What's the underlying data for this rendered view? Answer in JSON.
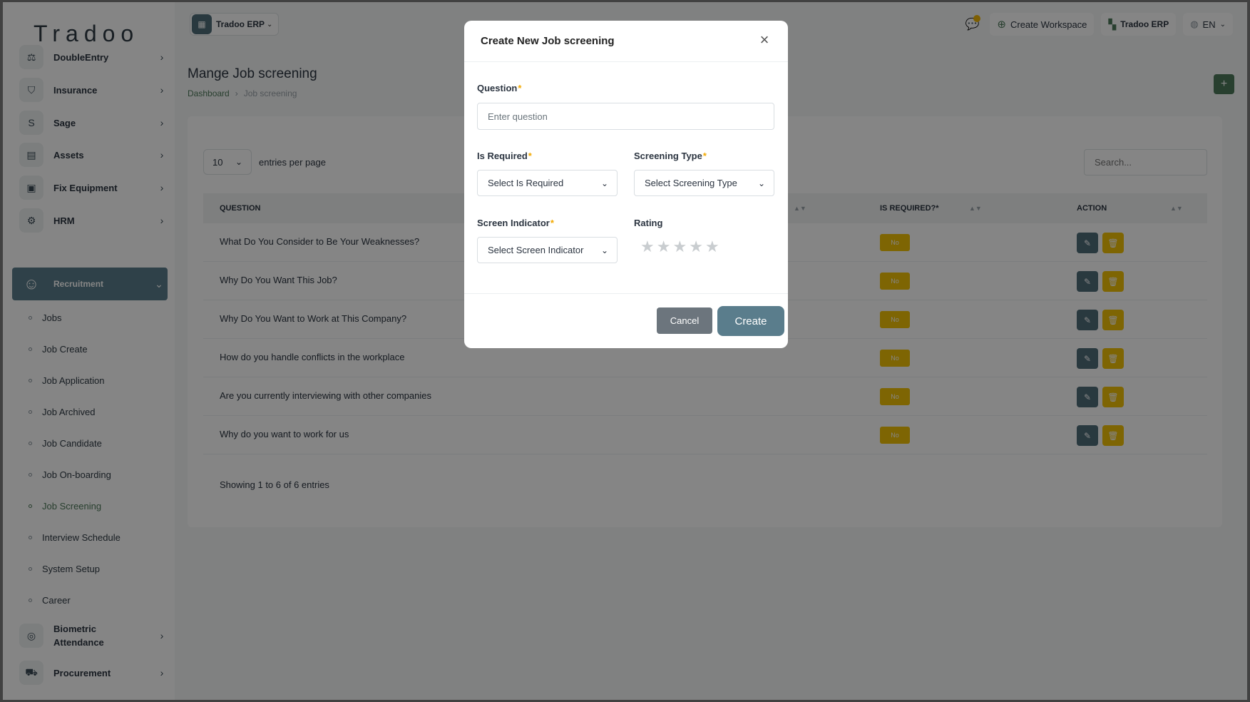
{
  "brand": {
    "logo_text": "Tradoo"
  },
  "sidebar": {
    "items": [
      {
        "label": "DoubleEntry",
        "icon": "scale-icon"
      },
      {
        "label": "Insurance",
        "icon": "shield-icon"
      },
      {
        "label": "Sage",
        "icon": "s-letter-icon"
      },
      {
        "label": "Assets",
        "icon": "calculator-icon"
      },
      {
        "label": "Fix Equipment",
        "icon": "archive-icon"
      },
      {
        "label": "HRM",
        "icon": "users-icon"
      },
      {
        "label": "Recruitment",
        "icon": "recruitment-icon"
      },
      {
        "label": "Biometric Attendance",
        "icon": "fingerprint-icon"
      },
      {
        "label": "Procurement",
        "icon": "cart-icon"
      }
    ],
    "recruitment_sub": [
      "Jobs",
      "Job Create",
      "Job Application",
      "Job Archived",
      "Job Candidate",
      "Job On-boarding",
      "Job Screening",
      "Interview Schedule",
      "System Setup",
      "Career"
    ],
    "active_sub": "Job Screening"
  },
  "topbar": {
    "workspace_label": "Tradoo ERP",
    "create_workspace": "Create Workspace",
    "erp_label": "Tradoo ERP",
    "language": "EN"
  },
  "page": {
    "title": "Mange Job screening",
    "breadcrumb": {
      "home": "Dashboard",
      "current": "Job screening"
    }
  },
  "table": {
    "entries_value": "10",
    "entries_label": "entries per page",
    "search_placeholder": "Search...",
    "headers": {
      "question": "QUESTION",
      "is_required": "IS REQUIRED?*",
      "action": "ACTION"
    },
    "rows": [
      {
        "question": "What Do You Consider to Be Your Weaknesses?",
        "is_required": "No"
      },
      {
        "question": "Why Do You Want This Job?",
        "is_required": "No"
      },
      {
        "question": "Why Do You Want to Work at This Company?",
        "is_required": "No"
      },
      {
        "question": "How do you handle conflicts in the workplace",
        "is_required": "No"
      },
      {
        "question": "Are you currently interviewing with other companies",
        "is_required": "No"
      },
      {
        "question": "Why do you want to work for us",
        "is_required": "No"
      }
    ],
    "showing": "Showing 1 to 6 of 6 entries"
  },
  "modal": {
    "title": "Create New Job screening",
    "question_label": "Question",
    "question_placeholder": "Enter question",
    "is_required_label": "Is Required",
    "is_required_value": "Select Is Required",
    "screening_type_label": "Screening Type",
    "screening_type_value": "Select Screening Type",
    "screen_indicator_label": "Screen Indicator",
    "screen_indicator_value": "Select Screen Indicator",
    "rating_label": "Rating",
    "rating_value": 0,
    "rating_max": 5,
    "cancel": "Cancel",
    "create": "Create",
    "required_mark": "*"
  },
  "colors": {
    "accent": "#5a7d8c",
    "brand_green": "#4e7a5a",
    "badge_yellow": "#f2c207",
    "edit_blue": "#4f6d7a"
  }
}
